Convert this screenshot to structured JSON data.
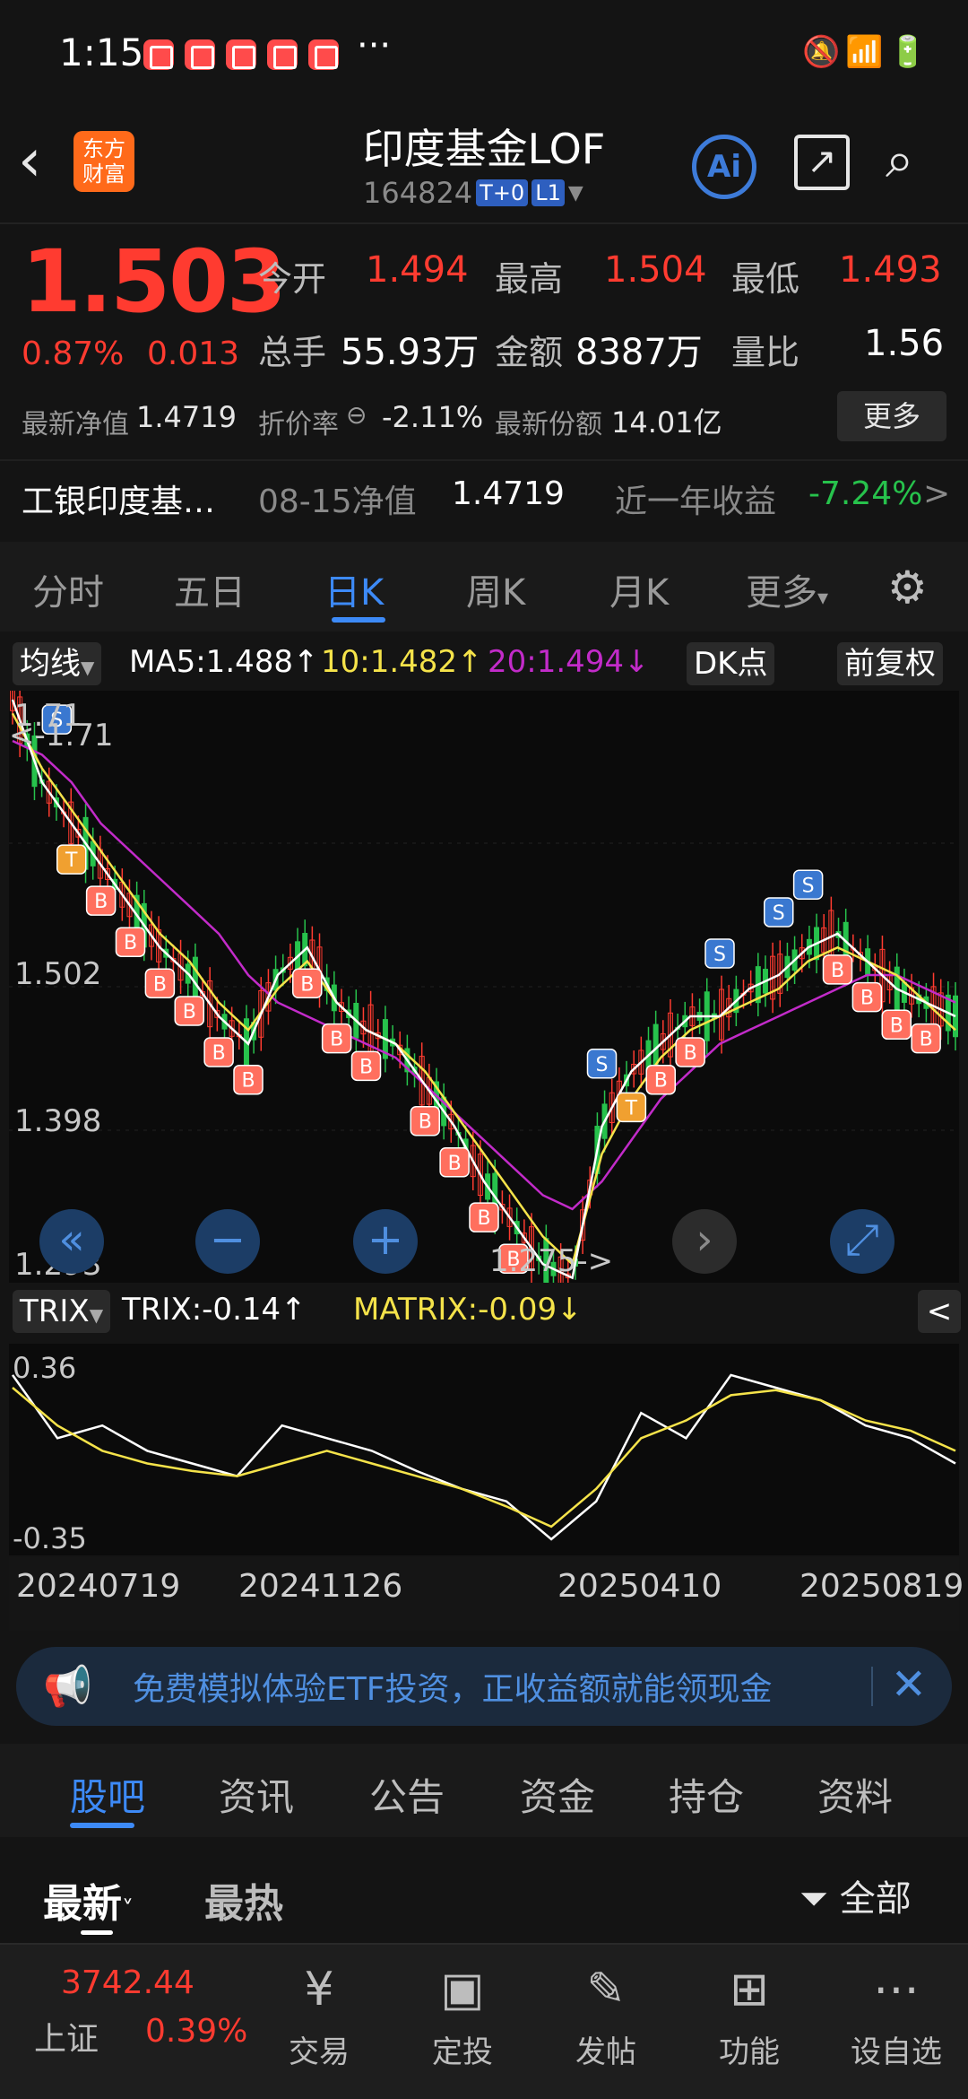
{
  "status_bar": {
    "time": "1:15",
    "more_dots": "···",
    "icons": [
      "mute-icon",
      "wifi-icon",
      "signal-icon",
      "signal-icon",
      "battery-charging-icon"
    ]
  },
  "header": {
    "title": "印度基金LOF",
    "code": "164824",
    "tags": [
      "T+0",
      "L1"
    ],
    "logo_text": "东方财富",
    "ai_label": "Ai"
  },
  "quote": {
    "price": "1.503",
    "change_pct": "0.87%",
    "change_abs": "0.013",
    "open_label": "今开",
    "open": "1.494",
    "high_label": "最高",
    "high": "1.504",
    "low_label": "最低",
    "low": "1.493",
    "volume_label": "总手",
    "volume": "55.93万",
    "amount_label": "金额",
    "amount": "8387万",
    "ratio_label": "量比",
    "ratio": "1.56",
    "nav_label": "最新净值",
    "nav": "1.4719",
    "discount_label": "折价率",
    "discount": "-2.11%",
    "shares_label": "最新份额",
    "shares": "14.01亿",
    "more_button": "更多"
  },
  "related": {
    "name": "工银印度基…",
    "nav_date_label": "08-15净值",
    "nav": "1.4719",
    "year_return_label": "近一年收益",
    "year_return": "-7.24%",
    "arrow": ">"
  },
  "chart_tabs": [
    "分时",
    "五日",
    "日K",
    "周K",
    "月K",
    "更多"
  ],
  "chart_tabs_active": 2,
  "indicators": {
    "ma_selector": "均线",
    "ma5": "MA5:1.488↑",
    "ma10": "10:1.482↑",
    "ma20": "20:1.494↓",
    "dk_button": "DK点",
    "fq_button": "前复权",
    "trix_selector": "TRIX",
    "trix": "TRIX:-0.14↑",
    "matrix": "MATRIX:-0.09↓",
    "collapse_button": "<"
  },
  "colors": {
    "up": "#ff3b30",
    "down": "#27c24c",
    "ma5": "#ffffff",
    "ma10": "#f5e34a",
    "ma20": "#c22bc9",
    "accent": "#3d8af7"
  },
  "chart_data": {
    "type": "line",
    "title": "",
    "y_ticks": [
      "1.71",
      "1.502",
      "1.398",
      "1.293"
    ],
    "ylim": [
      1.293,
      1.71
    ],
    "max_label": "1.71",
    "min_label": "1.275",
    "trix_ticks": [
      "0.36",
      "-0.35"
    ],
    "x_ticks": [
      "20240719",
      "20241126",
      "20250410",
      "20250819"
    ],
    "series": [
      {
        "name": "MA20",
        "values": [
          1.68,
          1.67,
          1.65,
          1.62,
          1.6,
          1.58,
          1.56,
          1.54,
          1.51,
          1.49,
          1.48,
          1.47,
          1.46,
          1.45,
          1.43,
          1.41,
          1.39,
          1.37,
          1.35,
          1.34,
          1.36,
          1.39,
          1.42,
          1.44,
          1.46,
          1.47,
          1.48,
          1.49,
          1.5,
          1.51,
          1.51,
          1.5,
          1.49
        ]
      },
      {
        "name": "MA10",
        "values": [
          1.7,
          1.66,
          1.63,
          1.6,
          1.57,
          1.54,
          1.52,
          1.49,
          1.47,
          1.5,
          1.52,
          1.49,
          1.47,
          1.46,
          1.44,
          1.41,
          1.38,
          1.35,
          1.32,
          1.3,
          1.38,
          1.42,
          1.45,
          1.47,
          1.48,
          1.49,
          1.5,
          1.52,
          1.53,
          1.52,
          1.51,
          1.49,
          1.47
        ]
      },
      {
        "name": "MA5",
        "values": [
          1.71,
          1.65,
          1.62,
          1.59,
          1.56,
          1.53,
          1.51,
          1.48,
          1.46,
          1.51,
          1.53,
          1.49,
          1.47,
          1.46,
          1.43,
          1.4,
          1.36,
          1.33,
          1.3,
          1.29,
          1.4,
          1.44,
          1.46,
          1.48,
          1.48,
          1.5,
          1.51,
          1.53,
          1.54,
          1.52,
          1.5,
          1.49,
          1.48
        ]
      },
      {
        "name": "TRIX",
        "values": [
          0.3,
          0.05,
          0.1,
          0.0,
          -0.05,
          -0.1,
          0.1,
          0.05,
          0.0,
          -0.08,
          -0.15,
          -0.2,
          -0.35,
          -0.2,
          0.15,
          0.05,
          0.3,
          0.25,
          0.2,
          0.1,
          0.05,
          -0.05
        ]
      },
      {
        "name": "MATRIX",
        "values": [
          0.25,
          0.1,
          0.0,
          -0.05,
          -0.08,
          -0.1,
          -0.05,
          0.0,
          -0.05,
          -0.1,
          -0.15,
          -0.22,
          -0.3,
          -0.15,
          0.05,
          0.12,
          0.22,
          0.24,
          0.2,
          0.12,
          0.08,
          0.0
        ]
      }
    ]
  },
  "banner": {
    "text": "免费模拟体验ETF投资，正收益额就能领现金",
    "close": "✕"
  },
  "content_tabs": [
    "股吧",
    "资讯",
    "公告",
    "资金",
    "持仓",
    "资料"
  ],
  "content_tabs_active": 0,
  "sort_tabs": {
    "latest": "最新",
    "hot": "最热",
    "filter": "全部"
  },
  "bottom_nav": {
    "index_value": "3742.44",
    "index_name": "上证",
    "index_change": "0.39%",
    "items": [
      {
        "label": "交易",
        "icon": "yuan-trade-icon"
      },
      {
        "label": "定投",
        "icon": "chart-calendar-icon"
      },
      {
        "label": "发帖",
        "icon": "edit-icon"
      },
      {
        "label": "功能",
        "icon": "grid-icon"
      },
      {
        "label": "设自选",
        "icon": "more-icon"
      }
    ]
  }
}
